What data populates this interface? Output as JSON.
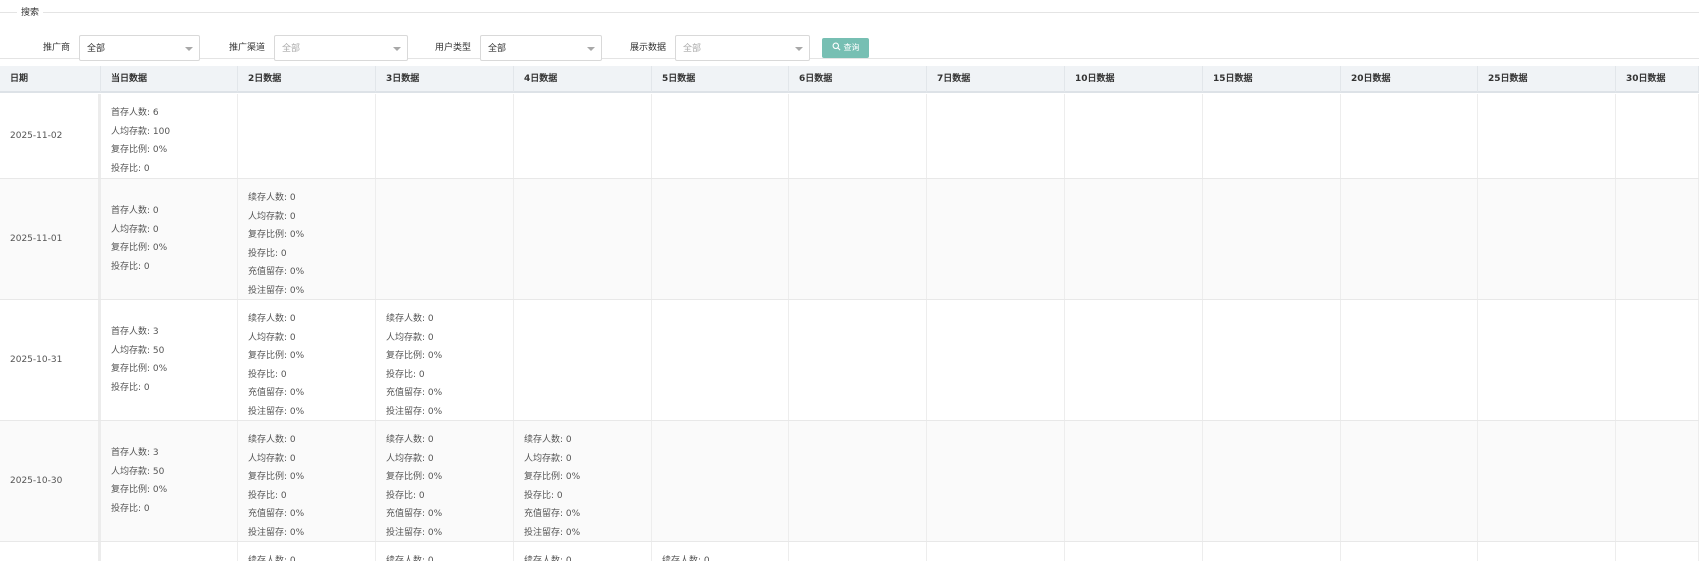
{
  "search": {
    "legend": "搜索",
    "fields": [
      {
        "label": "推广商",
        "value": "全部",
        "placeholder": false
      },
      {
        "label": "推广渠道",
        "value": "全部",
        "placeholder": true
      },
      {
        "label": "用户类型",
        "value": "全部",
        "placeholder": false
      },
      {
        "label": "展示数据",
        "value": "全部",
        "placeholder": true
      }
    ],
    "query_label": "查询"
  },
  "table": {
    "headers": [
      "日期",
      "当日数据",
      "2日数据",
      "3日数据",
      "4日数据",
      "5日数据",
      "6日数据",
      "7日数据",
      "10日数据",
      "15日数据",
      "20日数据",
      "25日数据",
      "30日数据"
    ],
    "rows": [
      {
        "date": "2025-11-02",
        "cells": [
          [
            "首存人数: 6",
            "人均存款: 100",
            "复存比例: 0%",
            "投存比: 0"
          ]
        ]
      },
      {
        "date": "2025-11-01",
        "cells": [
          [
            "首存人数: 0",
            "人均存款: 0",
            "复存比例: 0%",
            "投存比: 0"
          ],
          [
            "续存人数: 0",
            "人均存款: 0",
            "复存比例: 0%",
            "投存比: 0",
            "充值留存: 0%",
            "投注留存: 0%"
          ]
        ]
      },
      {
        "date": "2025-10-31",
        "cells": [
          [
            "首存人数: 3",
            "人均存款: 50",
            "复存比例: 0%",
            "投存比: 0"
          ],
          [
            "续存人数: 0",
            "人均存款: 0",
            "复存比例: 0%",
            "投存比: 0",
            "充值留存: 0%",
            "投注留存: 0%"
          ],
          [
            "续存人数: 0",
            "人均存款: 0",
            "复存比例: 0%",
            "投存比: 0",
            "充值留存: 0%",
            "投注留存: 0%"
          ]
        ]
      },
      {
        "date": "2025-10-30",
        "cells": [
          [
            "首存人数: 3",
            "人均存款: 50",
            "复存比例: 0%",
            "投存比: 0"
          ],
          [
            "续存人数: 0",
            "人均存款: 0",
            "复存比例: 0%",
            "投存比: 0",
            "充值留存: 0%",
            "投注留存: 0%"
          ],
          [
            "续存人数: 0",
            "人均存款: 0",
            "复存比例: 0%",
            "投存比: 0",
            "充值留存: 0%",
            "投注留存: 0%"
          ],
          [
            "续存人数: 0",
            "人均存款: 0",
            "复存比例: 0%",
            "投存比: 0",
            "充值留存: 0%",
            "投注留存: 0%"
          ]
        ]
      },
      {
        "date": "",
        "cells": [
          [],
          [
            "续存人数: 0"
          ],
          [
            "续存人数: 0"
          ],
          [
            "续存人数: 0"
          ],
          [
            "续存人数: 0"
          ]
        ]
      }
    ]
  },
  "colors": {
    "query_button": "#77bfb3",
    "header_bg": "#f0f3f6"
  },
  "icons": {
    "query_button_icon": "search-icon",
    "select_caret": "caret-down-icon"
  }
}
